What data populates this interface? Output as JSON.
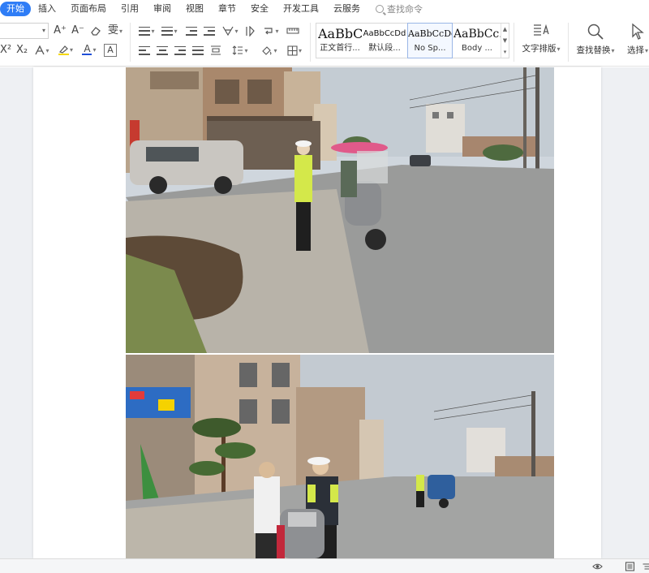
{
  "menu": {
    "tabs": [
      {
        "label": "开始",
        "active": true
      },
      {
        "label": "插入"
      },
      {
        "label": "页面布局"
      },
      {
        "label": "引用"
      },
      {
        "label": "审阅"
      },
      {
        "label": "视图"
      },
      {
        "label": "章节"
      },
      {
        "label": "安全"
      },
      {
        "label": "开发工具"
      },
      {
        "label": "云服务"
      }
    ],
    "search_label": "查找命令"
  },
  "ribbon": {
    "styles": [
      {
        "sample": "AaBbC",
        "label": "正文首行..."
      },
      {
        "sample": "AaBbCcDd",
        "label": "默认段..."
      },
      {
        "sample": "AaBbCcDd",
        "label": "No Sp...",
        "selected": true
      },
      {
        "sample": "AaBbCc.",
        "label": "Body ..."
      }
    ],
    "text_layout_label": "文字排版",
    "find_replace_label": "查找替换",
    "select_label": "选择",
    "format_glyphs": {
      "grow_font": "A⁺",
      "shrink_font": "A⁻",
      "superscript": "X²",
      "subscript": "X₂",
      "wen_phonetic": "雯",
      "char_border": "A"
    }
  },
  "colors": {
    "accent": "#2f7df6",
    "font_color_bar": "#1f4fd8",
    "highlight_bar": "#f5d800",
    "workspace_bg": "#eef0f3"
  },
  "document": {
    "images": [
      {
        "description": "traffic-police-scene-1"
      },
      {
        "description": "traffic-police-scene-2"
      }
    ]
  }
}
